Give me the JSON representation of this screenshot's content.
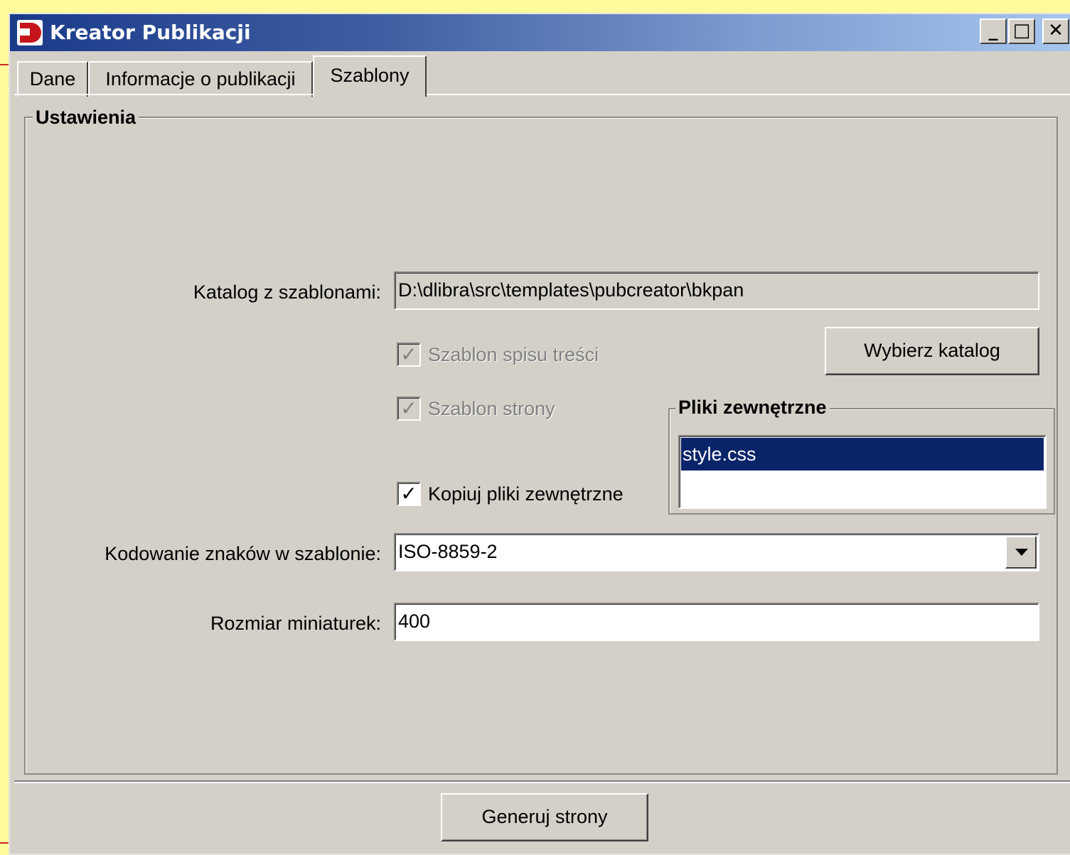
{
  "window": {
    "title": "Kreator Publikacji",
    "controls": {
      "minimize": "_",
      "maximize": "□",
      "close": "✕"
    }
  },
  "tabs": [
    {
      "label": "Dane",
      "active": false
    },
    {
      "label": "Informacje o publikacji",
      "active": false
    },
    {
      "label": "Szablony",
      "active": true
    }
  ],
  "settings": {
    "group_title": "Ustawienia",
    "template_dir_label": "Katalog z szablonami:",
    "template_dir_value": "D:\\dlibra\\src\\templates\\pubcreator\\bkpan",
    "choose_dir_button": "Wybierz katalog",
    "checkboxes": [
      {
        "label": "Szablon spisu treści",
        "checked": true,
        "enabled": false
      },
      {
        "label": "Szablon strony",
        "checked": true,
        "enabled": false
      },
      {
        "label": "Kopiuj pliki zewnętrzne",
        "checked": true,
        "enabled": true
      }
    ],
    "external_files": {
      "title": "Pliki zewnętrzne",
      "items": [
        "style.css"
      ],
      "selected": "style.css"
    },
    "encoding_label": "Kodowanie znaków w szablonie:",
    "encoding_value": "ISO-8859-2",
    "thumb_size_label": "Rozmiar miniaturek:",
    "thumb_size_value": "400"
  },
  "footer": {
    "generate_button": "Generuj strony"
  },
  "colors": {
    "selection": "#0a246a",
    "face": "#d4d0c8",
    "title_start": "#1a3b8a",
    "title_end": "#a6c6ee",
    "background": "#fffb9c"
  },
  "icons": {
    "app": "dlibra-logo-icon",
    "check": "check-mark-icon",
    "dropdown": "chevron-down-icon"
  }
}
